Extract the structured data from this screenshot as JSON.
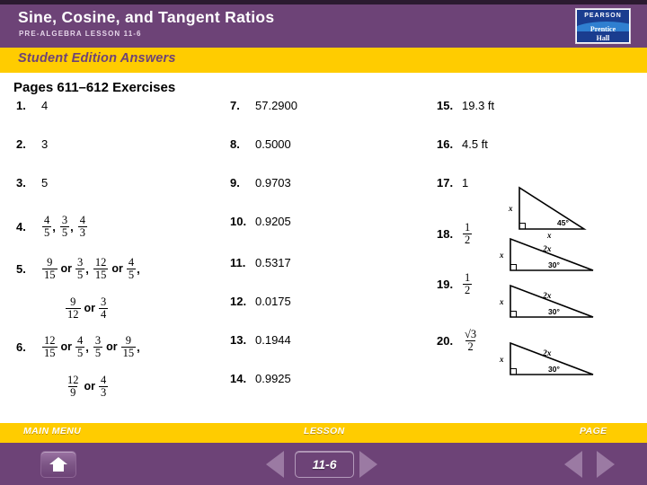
{
  "header": {
    "title": "Sine, Cosine, and Tangent Ratios",
    "subtitle": "PRE-ALGEBRA LESSON 11-6",
    "logo": {
      "brand": "PEARSON",
      "imprint_line1": "Prentice",
      "imprint_line2": "Hall"
    }
  },
  "banner": {
    "label": "Student Edition Answers"
  },
  "content": {
    "heading": "Pages 611–612 Exercises",
    "column1": [
      {
        "num": "1.",
        "answer": "4"
      },
      {
        "num": "2.",
        "answer": "3"
      },
      {
        "num": "3.",
        "answer": "5"
      },
      {
        "num": "4.",
        "parts": [
          {
            "type": "frac",
            "n": "4",
            "d": "5"
          },
          {
            "type": "text",
            "t": ","
          },
          {
            "type": "frac",
            "n": "3",
            "d": "5"
          },
          {
            "type": "text",
            "t": ","
          },
          {
            "type": "frac",
            "n": "4",
            "d": "3"
          }
        ]
      },
      {
        "num": "5.",
        "parts": [
          {
            "type": "frac",
            "n": "9",
            "d": "15"
          },
          {
            "type": "op",
            "t": "or"
          },
          {
            "type": "frac",
            "n": "3",
            "d": "5"
          },
          {
            "type": "text",
            "t": ","
          },
          {
            "type": "frac",
            "n": "12",
            "d": "15"
          },
          {
            "type": "op",
            "t": "or"
          },
          {
            "type": "frac",
            "n": "4",
            "d": "5"
          },
          {
            "type": "text",
            "t": ","
          }
        ]
      },
      {
        "num": "",
        "parts": [
          {
            "type": "frac",
            "n": "9",
            "d": "12"
          },
          {
            "type": "op",
            "t": "or"
          },
          {
            "type": "frac",
            "n": "3",
            "d": "4"
          }
        ]
      },
      {
        "num": "6.",
        "parts": [
          {
            "type": "frac",
            "n": "12",
            "d": "15"
          },
          {
            "type": "op",
            "t": "or"
          },
          {
            "type": "frac",
            "n": "4",
            "d": "5"
          },
          {
            "type": "text",
            "t": ","
          },
          {
            "type": "frac",
            "n": "3",
            "d": "5"
          },
          {
            "type": "op",
            "t": "or"
          },
          {
            "type": "frac",
            "n": "9",
            "d": "15"
          },
          {
            "type": "text",
            "t": ","
          }
        ]
      },
      {
        "num": "",
        "parts": [
          {
            "type": "frac",
            "n": "12",
            "d": "9"
          },
          {
            "type": "op",
            "t": "or"
          },
          {
            "type": "frac",
            "n": "4",
            "d": "3"
          }
        ]
      }
    ],
    "column2": [
      {
        "num": "7.",
        "answer": "57.2900"
      },
      {
        "num": "8.",
        "answer": "0.5000"
      },
      {
        "num": "9.",
        "answer": "0.9703"
      },
      {
        "num": "10.",
        "answer": "0.9205"
      },
      {
        "num": "11.",
        "answer": "0.5317"
      },
      {
        "num": "12.",
        "answer": "0.0175"
      },
      {
        "num": "13.",
        "answer": "0.1944"
      },
      {
        "num": "14.",
        "answer": "0.9925"
      }
    ],
    "column3": [
      {
        "num": "15.",
        "answer": "19.3 ft"
      },
      {
        "num": "16.",
        "answer": "4.5 ft"
      },
      {
        "num": "17.",
        "answer": "1"
      },
      {
        "num": "18.",
        "frac": {
          "n": "1",
          "d": "2"
        }
      },
      {
        "num": "19.",
        "frac": {
          "n": "1",
          "d": "2"
        }
      },
      {
        "num": "20.",
        "frac": {
          "n": "√3",
          "d": "2"
        }
      }
    ],
    "triangles": [
      {
        "id": "triangle-17",
        "angle": "45°",
        "leg_vertical": "x",
        "leg_horizontal": "x",
        "hypotenuse": ""
      },
      {
        "id": "triangle-18",
        "angle": "30°",
        "leg_vertical": "x",
        "leg_horizontal": "",
        "hypotenuse": "2x"
      },
      {
        "id": "triangle-19",
        "angle": "30°",
        "leg_vertical": "x",
        "leg_horizontal": "",
        "hypotenuse": "2x"
      },
      {
        "id": "triangle-20",
        "angle": "30°",
        "leg_vertical": "x",
        "leg_horizontal": "",
        "hypotenuse": "2x"
      }
    ]
  },
  "footer": {
    "main_menu_label": "MAIN MENU",
    "lesson_label": "LESSON",
    "page_label": "PAGE",
    "lesson_number": "11-6"
  },
  "colors": {
    "purple": "#6d4377",
    "yellow": "#ffcc00",
    "dark_strip": "#2b1a30"
  }
}
